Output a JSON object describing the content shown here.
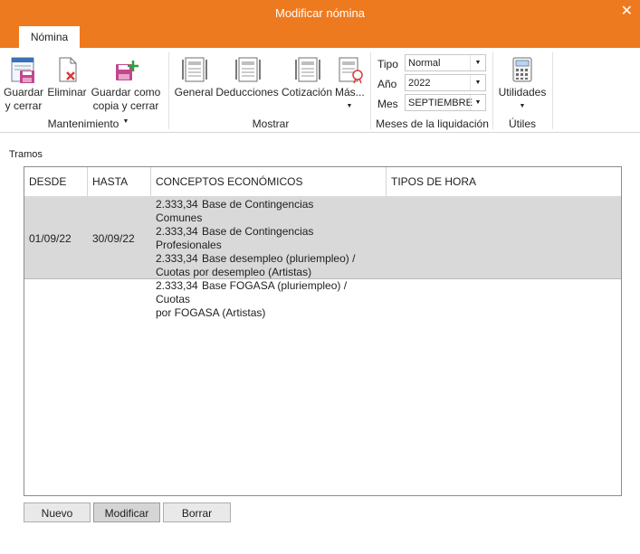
{
  "window": {
    "title": "Modificar nómina",
    "close_glyph": "✕"
  },
  "ribbon": {
    "tab": "Nómina",
    "groups": {
      "mantenimiento": "Mantenimiento",
      "mostrar": "Mostrar",
      "meses": "Meses de la liquidación",
      "utiles": "Útiles"
    },
    "buttons": {
      "guardar_l1": "Guardar",
      "guardar_l2": "y cerrar",
      "eliminar": "Eliminar",
      "copia_l1": "Guardar como",
      "copia_l2": "copia y cerrar",
      "general": "General",
      "deducciones": "Deducciones",
      "cotizacion": "Cotización",
      "mas": "Más...",
      "utilidades": "Utilidades"
    },
    "fields": {
      "tipo_label": "Tipo",
      "tipo_value": "Normal",
      "anio_label": "Año",
      "anio_value": "2022",
      "mes_label": "Mes",
      "mes_value": "SEPTIEMBRE"
    }
  },
  "tramos": {
    "label": "Tramos",
    "columns": [
      "DESDE",
      "HASTA",
      "CONCEPTOS ECONÓMICOS",
      "TIPOS DE HORA"
    ],
    "rows": [
      {
        "desde": "01/09/22",
        "hasta": "30/09/22",
        "conceptos": [
          {
            "valor": "2.333,34",
            "texto": "Base de Contingencias Comunes"
          },
          {
            "valor": "2.333,34",
            "texto": "Base de Contingencias Profesionales"
          },
          {
            "valor": "2.333,34",
            "texto": "Base desempleo (pluriempleo) /",
            "cont": "Cuotas por desempleo (Artistas)"
          },
          {
            "valor": "2.333,34",
            "texto": "Base FOGASA (pluriempleo) / Cuotas",
            "cont": "por FOGASA (Artistas)"
          }
        ],
        "tipos_hora": ""
      }
    ]
  },
  "actions": {
    "nuevo": "Nuevo",
    "modificar": "Modificar",
    "borrar": "Borrar"
  },
  "colors": {
    "titlebar": "#ee7a1f",
    "accent_red": "#d83b3b",
    "accent_green": "#2e9e3e",
    "selected_row": "#d9d9d9"
  }
}
